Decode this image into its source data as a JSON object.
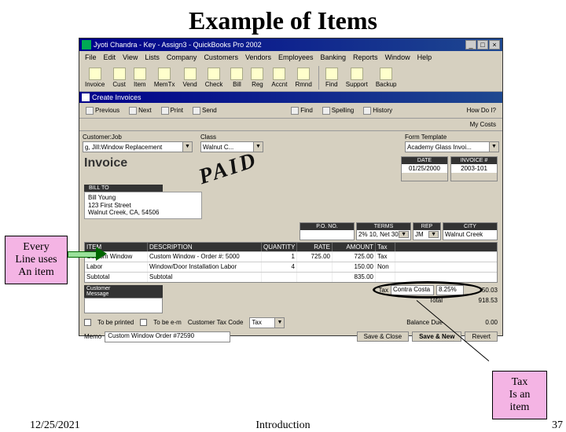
{
  "slide": {
    "title": "Example of Items",
    "date": "12/25/2021",
    "center": "Introduction",
    "page": "37"
  },
  "callouts": {
    "left": "Every\nLine uses\nAn item",
    "right": "Tax\nIs an\nitem"
  },
  "window": {
    "title": "Jyoti Chandra - Key - Assign3 - QuickBooks Pro 2002",
    "menu": [
      "File",
      "Edit",
      "View",
      "Lists",
      "Company",
      "Customers",
      "Vendors",
      "Employees",
      "Banking",
      "Reports",
      "Window",
      "Help"
    ],
    "toolbar": [
      "Invoice",
      "Cust",
      "Item",
      "MemTx",
      "Vend",
      "Check",
      "Bill",
      "Reg",
      "Accnt",
      "Rmnd",
      "Find",
      "Support",
      "Backup"
    ]
  },
  "subwin": {
    "title": "Create Invoices"
  },
  "inv_toolbar": {
    "prev": "Previous",
    "next": "Next",
    "print": "Print",
    "send": "Send",
    "find": "Find",
    "spelling": "Spelling",
    "history": "History",
    "howdoi": "How Do I?",
    "mycosts": "My Costs"
  },
  "form": {
    "customer_job_label": "Customer:Job",
    "customer_job": "g, Jill:Window Replacement",
    "class_label": "Class",
    "class": "Walnut C...",
    "form_template_label": "Form Template",
    "form_template": "Academy Glass Invoi..."
  },
  "header": {
    "invoice_word": "Invoice",
    "paid": "PAID",
    "date_label": "DATE",
    "date": "01/25/2000",
    "invnum_label": "INVOICE #",
    "invnum": "2003-101"
  },
  "billto": {
    "label": "BILL TO",
    "name": "Bill Young",
    "street": "123 First Street",
    "city": "Walnut Creek, CA, 54506"
  },
  "poboxes": {
    "po_label": "P.O. NO.",
    "po": "",
    "terms_label": "TERMS",
    "terms": "2% 10, Net 30",
    "rep_label": "REP",
    "rep": "JM",
    "city_label": "CITY",
    "city": "Walnut Creek"
  },
  "table": {
    "headers": {
      "item": "ITEM",
      "desc": "DESCRIPTION",
      "qty": "QUANTITY",
      "rate": "RATE",
      "amt": "AMOUNT",
      "tax": "Tax"
    },
    "rows": [
      {
        "item": "Custom Window",
        "desc": "Custom Window - Order #: 5000",
        "qty": "1",
        "rate": "725.00",
        "amt": "725.00",
        "tax": "Tax"
      },
      {
        "item": "Labor",
        "desc": "Window/Door Installation Labor",
        "qty": "4",
        "rate": "",
        "amt": "150.00",
        "tax": "Non"
      },
      {
        "item": "Subtotal",
        "desc": "Subtotal",
        "qty": "",
        "rate": "",
        "amt": "835.00",
        "tax": ""
      }
    ]
  },
  "tax": {
    "label": "Tax",
    "item": "Contra Costa",
    "pct": "8.25%",
    "amount": "50.03"
  },
  "totals": {
    "total_label": "Total",
    "total": "918.53",
    "bal_label": "Balance Due",
    "bal": "0.00"
  },
  "custmsg": {
    "label": "Customer\nMessage"
  },
  "bottom": {
    "printed": "To be printed",
    "email": "To be e-m",
    "custtax_label": "Customer Tax Code",
    "custtax": "Tax",
    "save_close": "Save & Close",
    "save_new": "Save & New",
    "revert": "Revert"
  },
  "memo": {
    "label": "Memo",
    "value": "Custom Window Order #72590"
  }
}
